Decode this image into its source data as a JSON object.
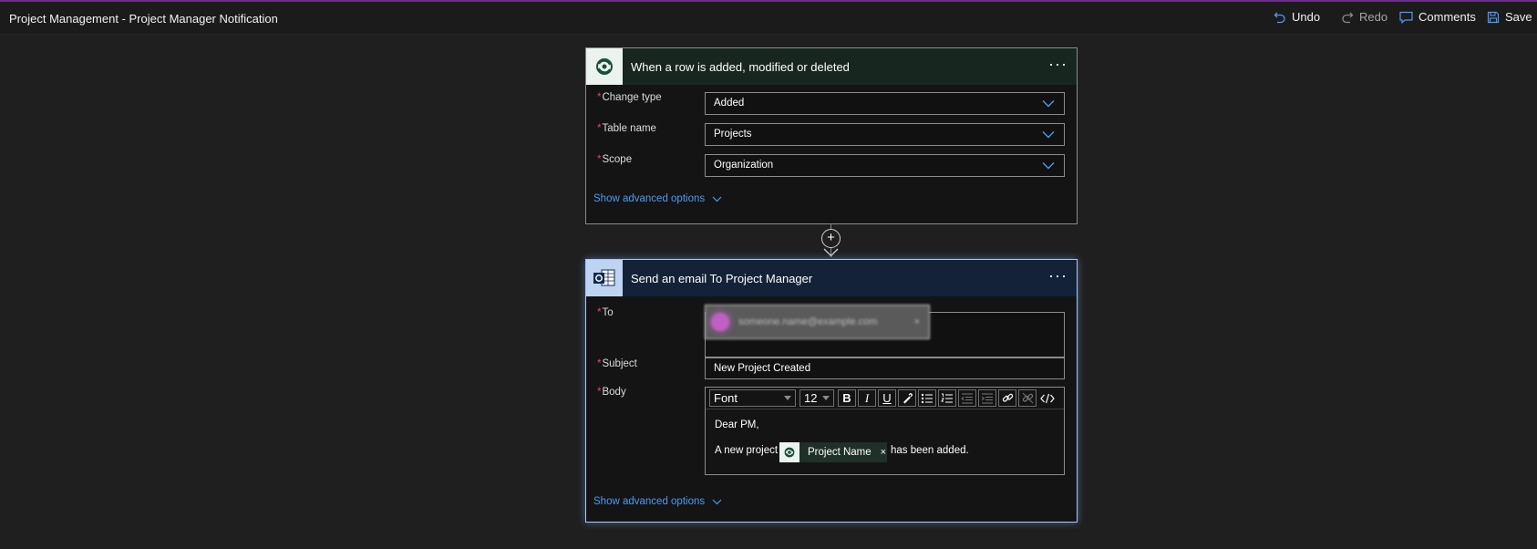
{
  "app": {
    "title": "Project Management - Project Manager Notification"
  },
  "toolbar": {
    "undo_label": "Undo",
    "redo_label": "Redo",
    "comments_label": "Comments",
    "save_label": "Save"
  },
  "trigger": {
    "title": "When a row is added, modified or deleted",
    "more_label": "···",
    "fields": [
      {
        "label": "Change type",
        "value": "Added"
      },
      {
        "label": "Table name",
        "value": "Projects"
      },
      {
        "label": "Scope",
        "value": "Organization"
      }
    ],
    "advanced_label": "Show advanced options"
  },
  "connector": {
    "plus_label": "+"
  },
  "email": {
    "title": "Send an email To Project Manager",
    "more_label": "···",
    "to_label": "To",
    "to_token": "someone.name@example.com",
    "subject_label": "Subject",
    "subject_value": "New Project Created",
    "body_label": "Body",
    "font_select": "Font",
    "size_select": "12",
    "body_line1": "Dear PM,",
    "body_line2_before": "A new project",
    "dynamic_chip": "Project Name",
    "chip_remove": "×",
    "body_line2_after": "has been added.",
    "advanced_label": "Show advanced options"
  },
  "colors": {
    "accent_link": "#4d9bf0",
    "required": "#e74856",
    "trigger_header": "#17261f",
    "action_header": "#132236",
    "selection_glow": "#a8c7fa"
  }
}
